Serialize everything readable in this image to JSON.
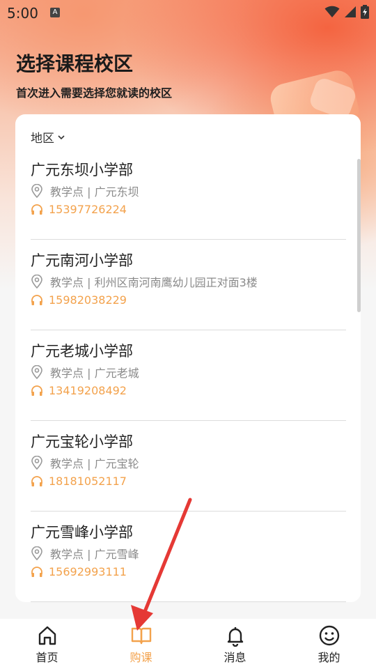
{
  "status_bar": {
    "time": "5:00",
    "notification_icon_label": "A",
    "icons": [
      "wifi-icon",
      "signal-icon",
      "battery-charging-icon"
    ]
  },
  "header": {
    "title": "选择课程校区",
    "subtitle": "首次进入需要选择您就读的校区"
  },
  "filter": {
    "region_label": "地区"
  },
  "campuses": [
    {
      "name": "广元东坝小学部",
      "address": "教学点 | 广元东坝",
      "phone": "15397726224"
    },
    {
      "name": "广元南河小学部",
      "address": "教学点 | 利州区南河南鹰幼儿园正对面3楼",
      "phone": "15982038229"
    },
    {
      "name": "广元老城小学部",
      "address": "教学点 | 广元老城",
      "phone": "13419208492"
    },
    {
      "name": "广元宝轮小学部",
      "address": "教学点 | 广元宝轮",
      "phone": "18181052117"
    },
    {
      "name": "广元雪峰小学部",
      "address": "教学点 | 广元雪峰",
      "phone": "15692993111"
    }
  ],
  "tabbar": {
    "tabs": [
      {
        "label": "首页",
        "icon": "home-icon",
        "active": false
      },
      {
        "label": "购课",
        "icon": "book-icon",
        "active": true
      },
      {
        "label": "消息",
        "icon": "bell-icon",
        "active": false
      },
      {
        "label": "我的",
        "icon": "smiley-icon",
        "active": false
      }
    ]
  },
  "colors": {
    "accent": "#f3a24c",
    "arrow": "#e53935"
  }
}
